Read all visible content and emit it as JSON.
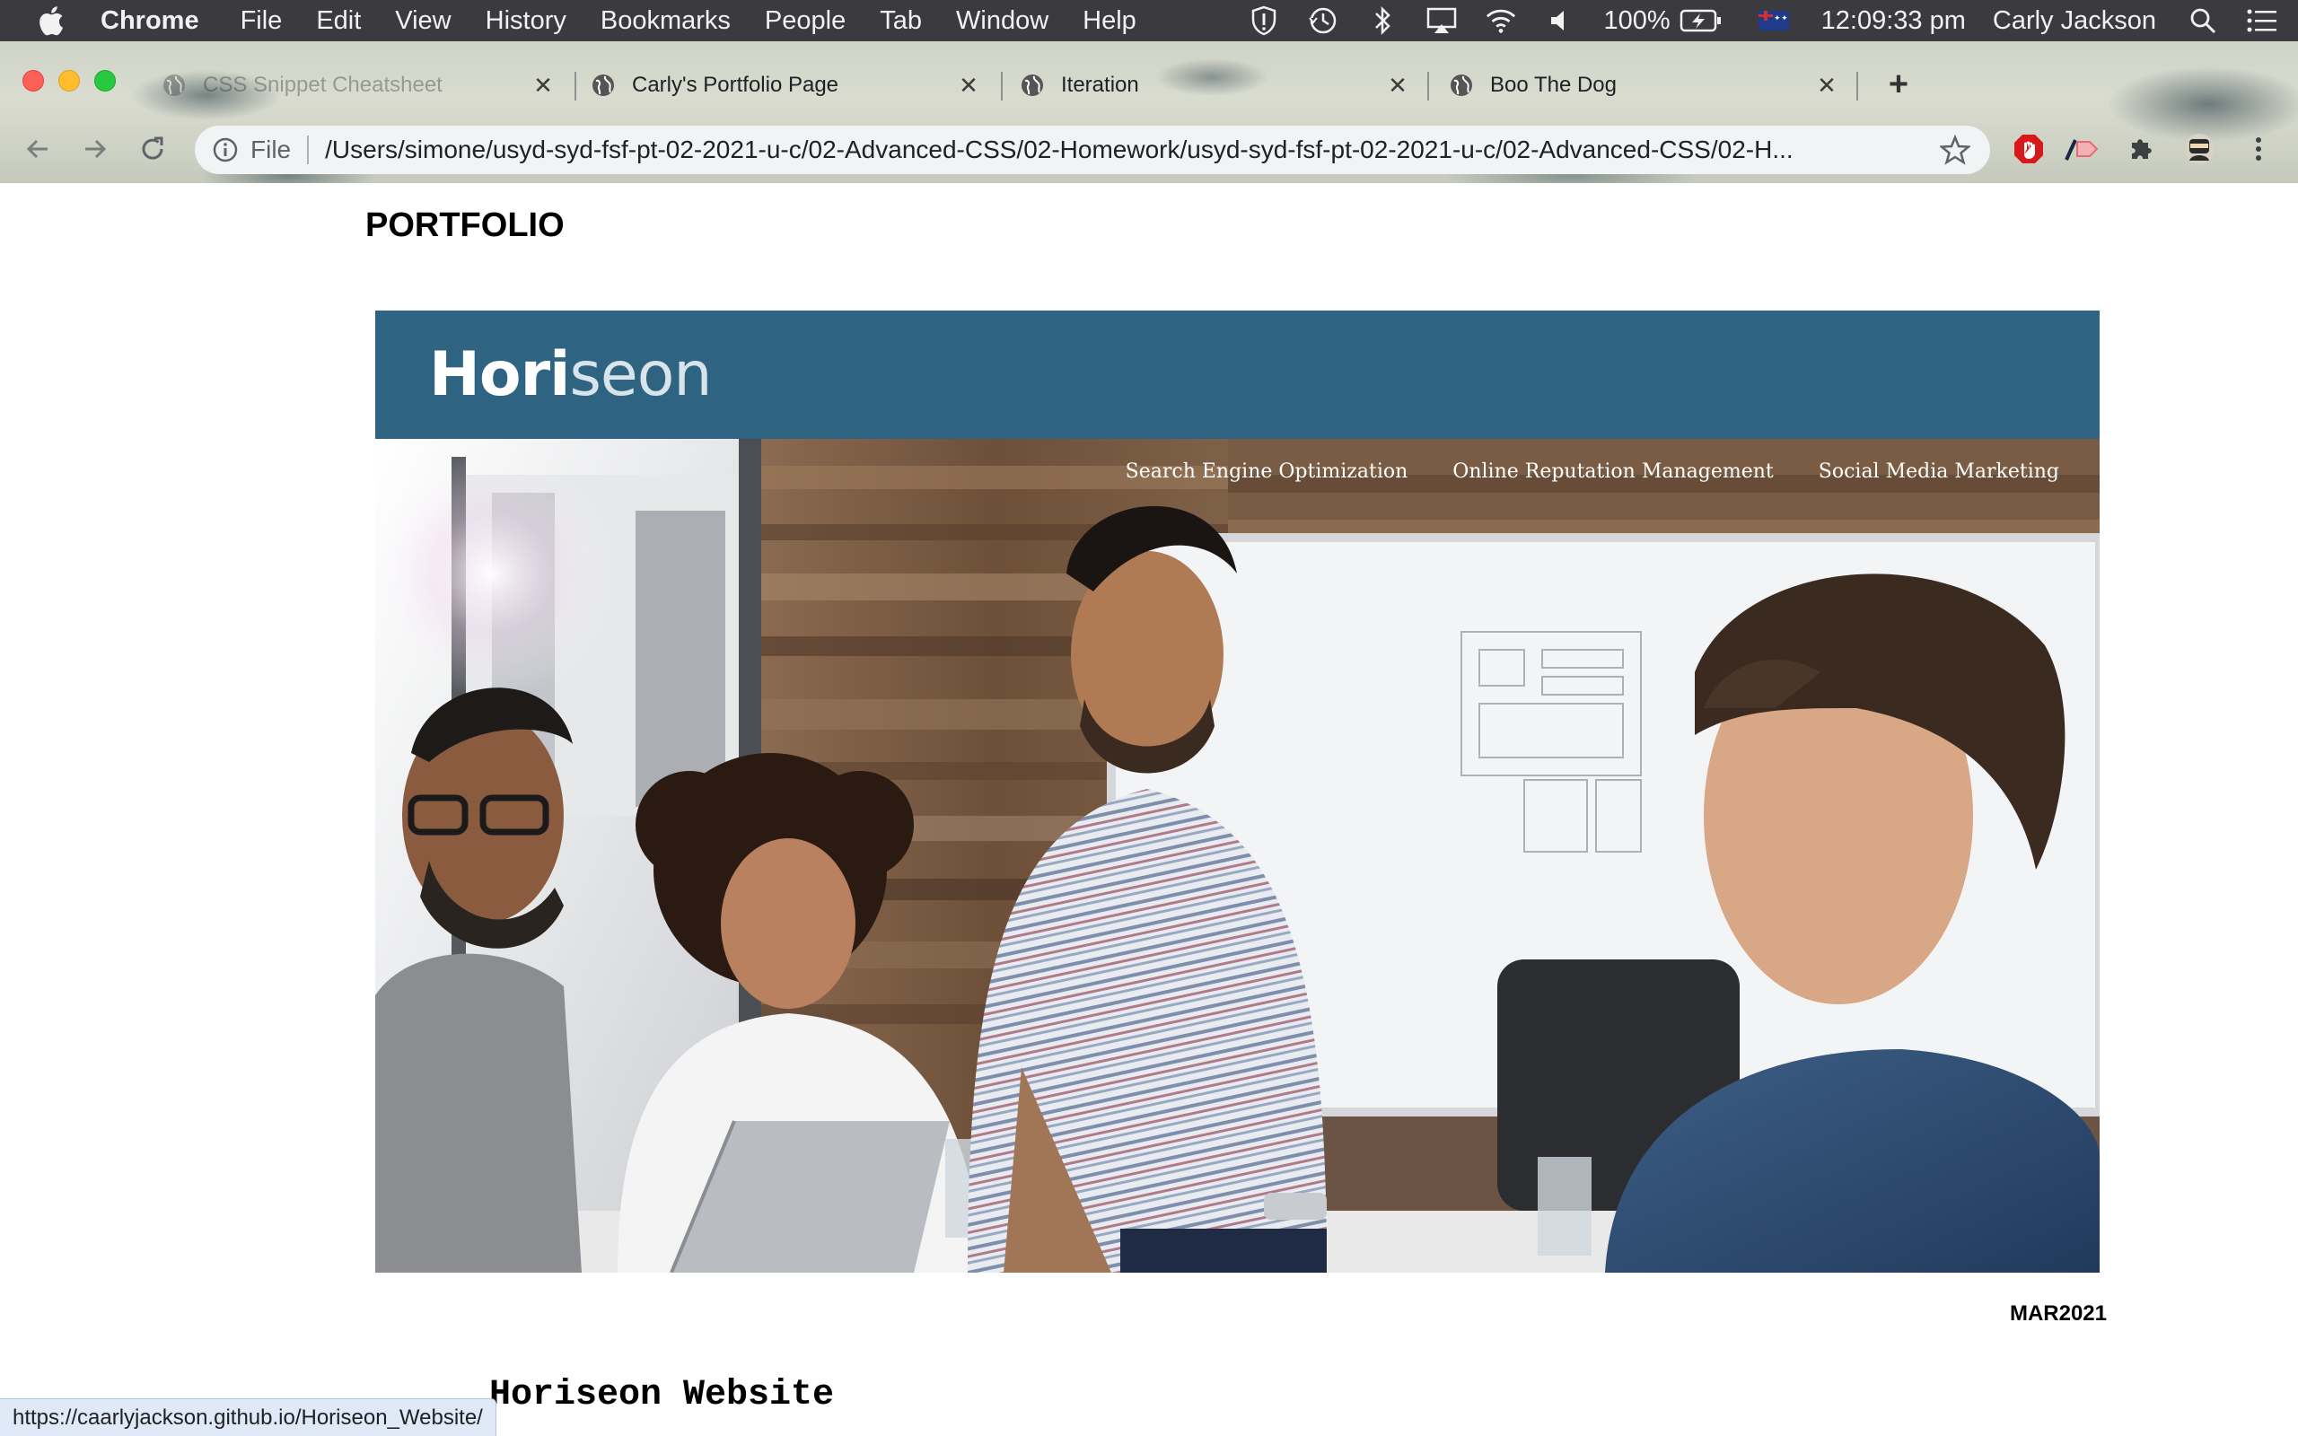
{
  "menubar": {
    "app_name": "Chrome",
    "menus": [
      "File",
      "Edit",
      "View",
      "History",
      "Bookmarks",
      "People",
      "Tab",
      "Window",
      "Help"
    ],
    "status_icons": [
      "shield-icon",
      "time-machine-icon",
      "bluetooth-icon",
      "airplay-icon",
      "wifi-icon",
      "volume-icon",
      "battery-icon",
      "flag-icon",
      "spotlight-icon",
      "notification-center-icon"
    ],
    "battery_percent": "100%",
    "clock": "12:09:33 pm",
    "user": "Carly Jackson"
  },
  "browser": {
    "tabs": [
      {
        "title": "CSS Snippet Cheatsheet",
        "icon": "globe-icon",
        "dimmed": true
      },
      {
        "title": "Carly's Portfolio Page",
        "icon": "globe-icon",
        "dimmed": false
      },
      {
        "title": "Iteration",
        "icon": "globe-icon",
        "dimmed": false
      },
      {
        "title": "Boo The Dog",
        "icon": "globe-icon",
        "dimmed": false
      }
    ],
    "omnibox": {
      "scheme_label": "File",
      "url": "/Users/simone/usyd-syd-fsf-pt-02-2021-u-c/02-Advanced-CSS/02-Homework/usyd-syd-fsf-pt-02-2021-u-c/02-Advanced-CSS/02-H..."
    },
    "extensions": [
      "adblock-icon",
      "arrow-extension-icon",
      "puzzle-icon",
      "profile-avatar-icon",
      "kebab-menu-icon"
    ]
  },
  "page": {
    "heading": "PORTFOLIO",
    "project": {
      "logo_bold": "Hori",
      "logo_light": "seon",
      "nav": [
        "Search Engine Optimization",
        "Online Reputation Management",
        "Social Media Marketing"
      ],
      "date": "MAR2021",
      "title": "Horiseon Website"
    }
  },
  "status_bar": {
    "link_url": "https://caarlyjackson.github.io/Horiseon_Website/"
  },
  "colors": {
    "header_blue": "#2e6381",
    "menubar_bg": "#3b3b3f",
    "omnibox_bg": "#f1f3f4",
    "status_bubble_bg": "#dfe9f7"
  }
}
